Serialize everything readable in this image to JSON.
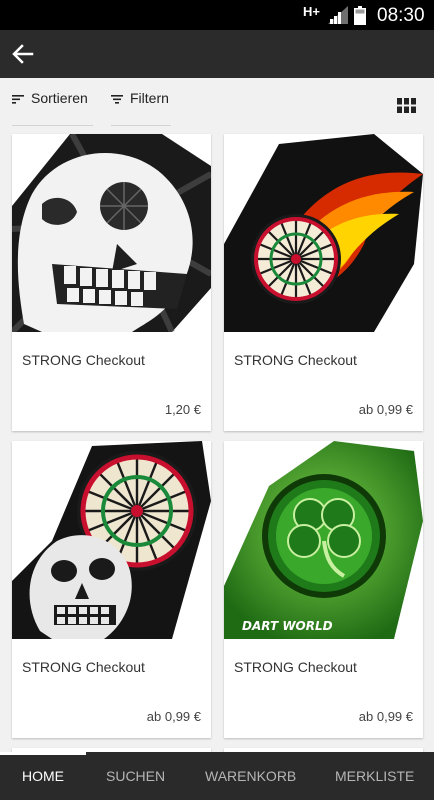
{
  "status_bar": {
    "network": "H+",
    "time": "08:30"
  },
  "app_bar": {
    "back_icon": "arrow-left-icon"
  },
  "toolbar": {
    "sort_label": "Sortieren",
    "sort_icon": "sort-icon",
    "filter_label": "Filtern",
    "filter_icon": "filter-icon",
    "view_icon": "grid-view-icon"
  },
  "products": [
    {
      "title": "STRONG Checkout",
      "price": "1,20 €",
      "image": "skull-dart-flight"
    },
    {
      "title": "STRONG Checkout",
      "price": "ab 0,99 €",
      "image": "fireball-dartboard-flight"
    },
    {
      "title": "STRONG Checkout",
      "price": "ab 0,99 €",
      "image": "skull-dartboard-flight"
    },
    {
      "title": "STRONG Checkout",
      "price": "ab 0,99 €",
      "image": "shamrock-dart-flight",
      "image_text": "DART WORLD"
    }
  ],
  "bottom_nav": {
    "items": [
      {
        "label": "HOME",
        "active": true
      },
      {
        "label": "SUCHEN",
        "active": false
      },
      {
        "label": "WARENKORB",
        "active": false
      },
      {
        "label": "MERKLISTE",
        "active": false
      }
    ]
  },
  "colors": {
    "status_bar": "#000000",
    "app_bar": "#2b2b2b",
    "bottom_nav": "#2a2a2a",
    "background": "#f1f1f1",
    "card": "#ffffff",
    "accent_fire": "#ff7a00",
    "clover_green": "#2e8b1e"
  }
}
